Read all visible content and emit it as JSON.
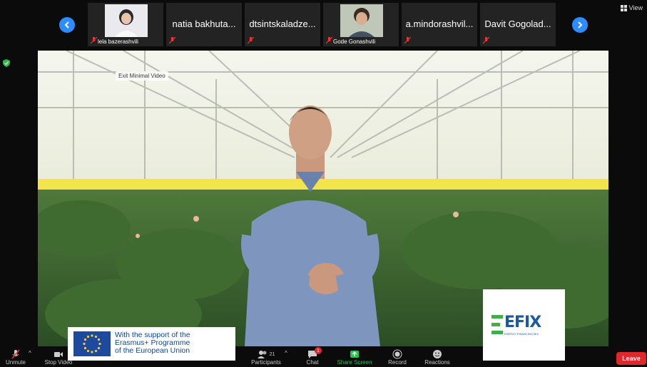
{
  "top_strip": {
    "participants": [
      {
        "name": "",
        "caption": "lela bazerashvili"
      },
      {
        "name": "natia bakhuta...",
        "caption": ""
      },
      {
        "name": "dtsintskaladze...",
        "caption": ""
      },
      {
        "name": "",
        "caption": "Gode Gonashvili"
      },
      {
        "name": "a.mindorashvil...",
        "caption": ""
      },
      {
        "name": "Davit Gogolad...",
        "caption": ""
      }
    ],
    "view_label": "View"
  },
  "main": {
    "tooltip": "Exit Minimal Video"
  },
  "logos": {
    "eu_text": [
      "With the support of the",
      "Erasmus+ Programme",
      "of the European Union"
    ],
    "efix_word": "EFIX",
    "efix_sub": "ENERGY FINANCING MIX"
  },
  "toolbar": {
    "unmute": "Unmute",
    "stop_video": "Stop Video",
    "participants": "Participants",
    "participants_count": "21",
    "chat": "Chat",
    "chat_badge": "1",
    "share_screen": "Share Screen",
    "record": "Record",
    "reactions": "Reactions",
    "leave": "Leave"
  },
  "colors": {
    "accent_blue": "#2d8cff",
    "leave_red": "#e02828",
    "share_green": "#23c552"
  }
}
